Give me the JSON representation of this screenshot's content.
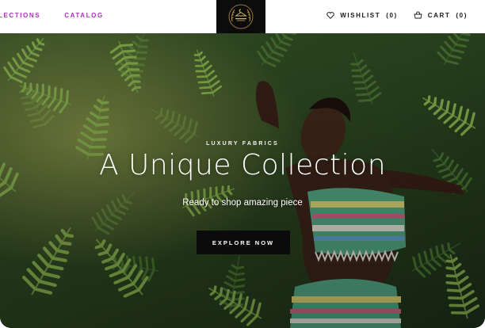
{
  "header": {
    "nav_left": [
      {
        "label": "LECTIONS"
      },
      {
        "label": "CATALOG"
      }
    ],
    "logo": {
      "icon": "hanger-wreath-logo"
    },
    "wishlist": {
      "label": "WISHLIST",
      "count": "(0)",
      "icon": "heart-icon"
    },
    "cart": {
      "label": "CART",
      "count": "(0)",
      "icon": "basket-icon"
    }
  },
  "hero": {
    "eyebrow": "LUXURY FABRICS",
    "headline": "A Unique Collection",
    "subtitle": "Ready to shop amazing piece",
    "cta_label": "EXPLORE NOW",
    "image": "woman-in-patterned-top-among-ferns"
  },
  "colors": {
    "nav_accent": "#b02fc4",
    "logo_bg": "#0c0c0c",
    "cta_bg": "#0b0b0b",
    "foliage": "#2e4a22"
  }
}
